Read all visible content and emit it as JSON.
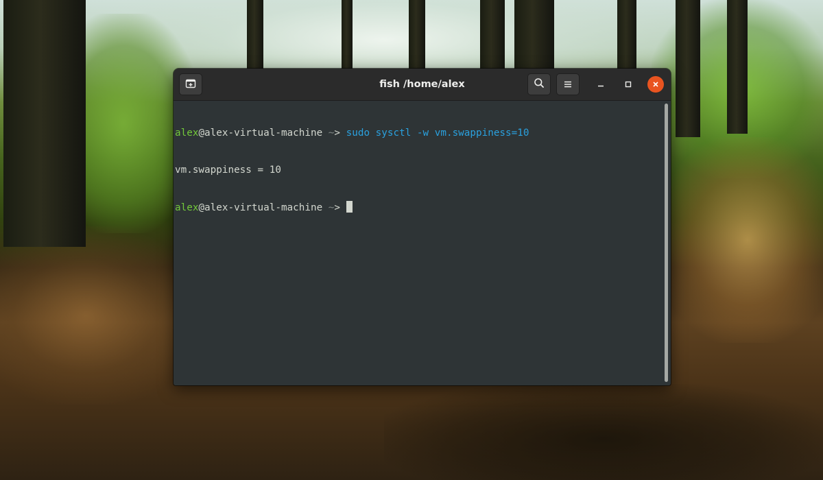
{
  "terminal": {
    "title": "fish /home/alex",
    "lines": [
      {
        "user": "alex",
        "at": "@",
        "host": "alex-virtual-machine",
        "dir": " ~",
        "prompt_symbol": "> ",
        "command": "sudo sysctl -w vm.swappiness=10"
      },
      {
        "output": "vm.swappiness = 10"
      },
      {
        "user": "alex",
        "at": "@",
        "host": "alex-virtual-machine",
        "dir": " ~",
        "prompt_symbol": "> "
      }
    ]
  },
  "header": {
    "new_tab_icon": "new-tab-icon",
    "search_icon": "search-icon",
    "menu_icon": "hamburger-menu-icon",
    "minimize_icon": "minimize-icon",
    "maximize_icon": "maximize-icon",
    "close_icon": "close-icon"
  },
  "colors": {
    "terminal_background": "#2e3436",
    "header_background": "#2b2b2b",
    "prompt_green": "#73c93a",
    "command_blue": "#2aa1df",
    "close_button": "#e95420",
    "text": "#d3d7cf"
  }
}
